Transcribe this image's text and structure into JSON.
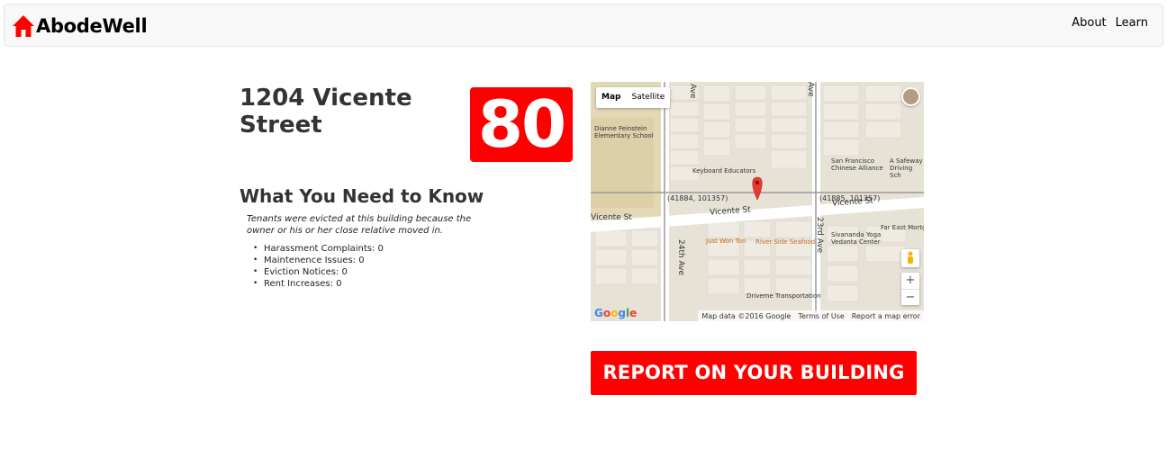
{
  "brand": {
    "name": "AbodeWell",
    "accent": "#ff0000"
  },
  "nav": {
    "links": [
      "About",
      "Learn"
    ]
  },
  "building": {
    "address": "1204 Vicente Street",
    "score": "80",
    "section_title": "What You Need to Know",
    "note": "Tenants were evicted at this building because the owner or his or her close relative moved in.",
    "stats": [
      "Harassment Complaints: 0",
      "Maintenence Issues: 0",
      "Eviction Notices: 0",
      "Rent Increases: 0"
    ]
  },
  "map": {
    "type_buttons": [
      "Map",
      "Satellite"
    ],
    "labels": {
      "school": "Dianne Feinstein Elementary School",
      "keyboard": "Keyboard Educators",
      "chinese": "San Francisco Chinese Alliance",
      "safeway": "A Safeway Driving Sch",
      "coord_left": "(41884, 101357)",
      "coord_right": "(41885, 101357)",
      "sivananda": "Sivananda Yoga Vedanta Center",
      "far_east": "Far East Mortg",
      "just_won_ton": "Just Won Ton",
      "river_side": "River Side Seafood",
      "driveme": "Driveme Transportation",
      "vicente_left": "Vicente St",
      "vicente_mid": "Vicente St",
      "vicente_right": "Vicente St",
      "ave_24th": "24th Ave",
      "ave_23rd": "23rd Ave",
      "ave_top_left": "Ave",
      "ave_top_right": "Ave"
    },
    "google": "Google",
    "footer": [
      "Map data ©2016 Google",
      "Terms of Use",
      "Report a map error"
    ],
    "zoom": [
      "+",
      "−"
    ]
  },
  "cta": {
    "label": "REPORT ON YOUR BUILDING"
  }
}
